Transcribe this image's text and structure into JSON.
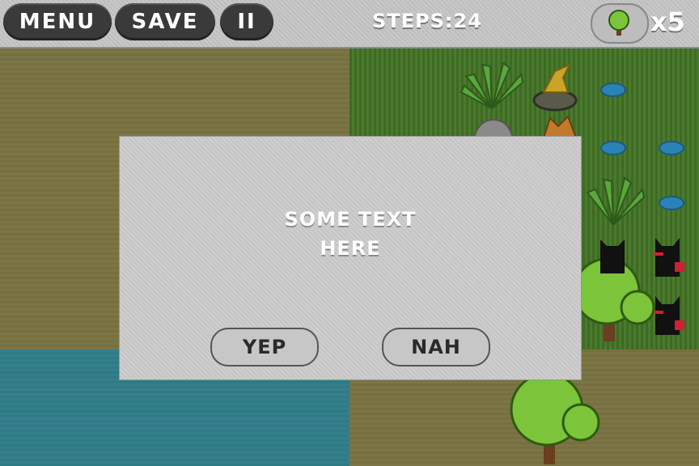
{
  "toolbar": {
    "menu_label": "MENU",
    "save_label": "SAVE",
    "pause_label": "II"
  },
  "status": {
    "steps_text": "STEPS:24",
    "tree_count": "x5"
  },
  "dialog": {
    "message": "SOME TEXT\nHERE",
    "yes_label": "YEP",
    "no_label": "NAH"
  },
  "icons": {
    "tree": "tree-icon",
    "pause": "pause-icon"
  },
  "colors": {
    "grass": "#4a7a2c",
    "sand": "#7a7444",
    "water": "#2e7b86",
    "pill": "#3a3a3a"
  }
}
